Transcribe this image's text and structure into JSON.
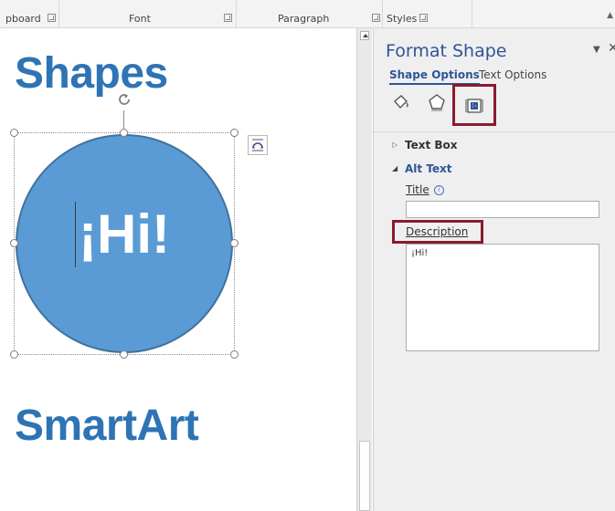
{
  "ribbon": {
    "groups": [
      {
        "label": "pboard",
        "launcher": true
      },
      {
        "label": "Font",
        "launcher": true
      },
      {
        "label": "Paragraph",
        "launcher": true
      },
      {
        "label": "Styles",
        "launcher": true
      }
    ]
  },
  "document": {
    "heading_shapes": "Shapes",
    "shape_text": "¡Hi!",
    "heading_smartart": "SmartArt",
    "shape_fill_color": "#5b9bd5",
    "heading_color": "#2e74b5"
  },
  "pane": {
    "title": "Format Shape",
    "tabs": [
      {
        "label": "Shape Options",
        "active": true
      },
      {
        "label": "Text Options",
        "active": false
      }
    ],
    "icon_tabs": [
      "fill-line-icon",
      "effects-icon",
      "size-properties-icon"
    ],
    "sections": [
      {
        "label": "Text Box",
        "expanded": false
      },
      {
        "label": "Alt Text",
        "expanded": true
      }
    ],
    "alt_text": {
      "title_label": "Title",
      "title_value": "",
      "description_label": "Description",
      "description_value": "¡Hi!"
    },
    "accent_color": "#2f5597",
    "highlight_color": "#8b1a2e"
  }
}
